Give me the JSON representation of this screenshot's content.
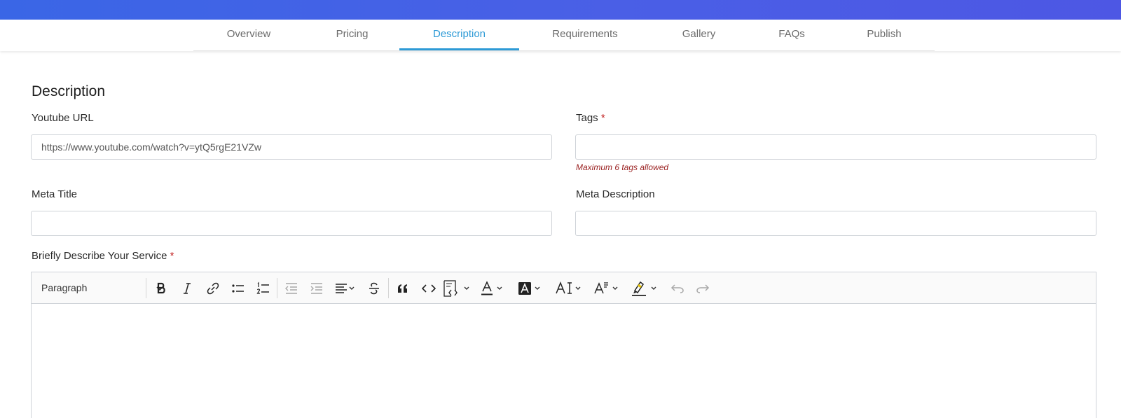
{
  "tabs": [
    {
      "label": "Overview"
    },
    {
      "label": "Pricing"
    },
    {
      "label": "Description"
    },
    {
      "label": "Requirements"
    },
    {
      "label": "Gallery"
    },
    {
      "label": "FAQs"
    },
    {
      "label": "Publish"
    }
  ],
  "active_tab": "Description",
  "section": {
    "title": "Description"
  },
  "form": {
    "youtube_url": {
      "label": "Youtube URL",
      "value": "https://www.youtube.com/watch?v=ytQ5rgE21VZw"
    },
    "tags": {
      "label": "Tags",
      "required_mark": "*",
      "value": "",
      "hint": "Maximum 6 tags allowed"
    },
    "meta_title": {
      "label": "Meta Title",
      "value": ""
    },
    "meta_description": {
      "label": "Meta Description",
      "value": ""
    },
    "describe_service": {
      "label": "Briefly Describe Your Service",
      "required_mark": "*"
    }
  },
  "editor": {
    "paragraph_select": "Paragraph",
    "heading_size_label": "AI",
    "toolbar_icons": [
      "bold-icon",
      "italic-icon",
      "link-icon",
      "bulleted-list-icon",
      "numbered-list-icon",
      "outdent-icon",
      "indent-icon",
      "align-icon",
      "strikethrough-icon",
      "blockquote-icon",
      "code-icon",
      "code-block-icon",
      "font-color-icon",
      "font-background-icon",
      "font-size-icon",
      "font-family-icon",
      "highlight-icon",
      "undo-icon",
      "redo-icon"
    ]
  },
  "colors": {
    "accent": "#2d9ad6",
    "required": "#c22424",
    "top_band": "#4a5fe6"
  }
}
